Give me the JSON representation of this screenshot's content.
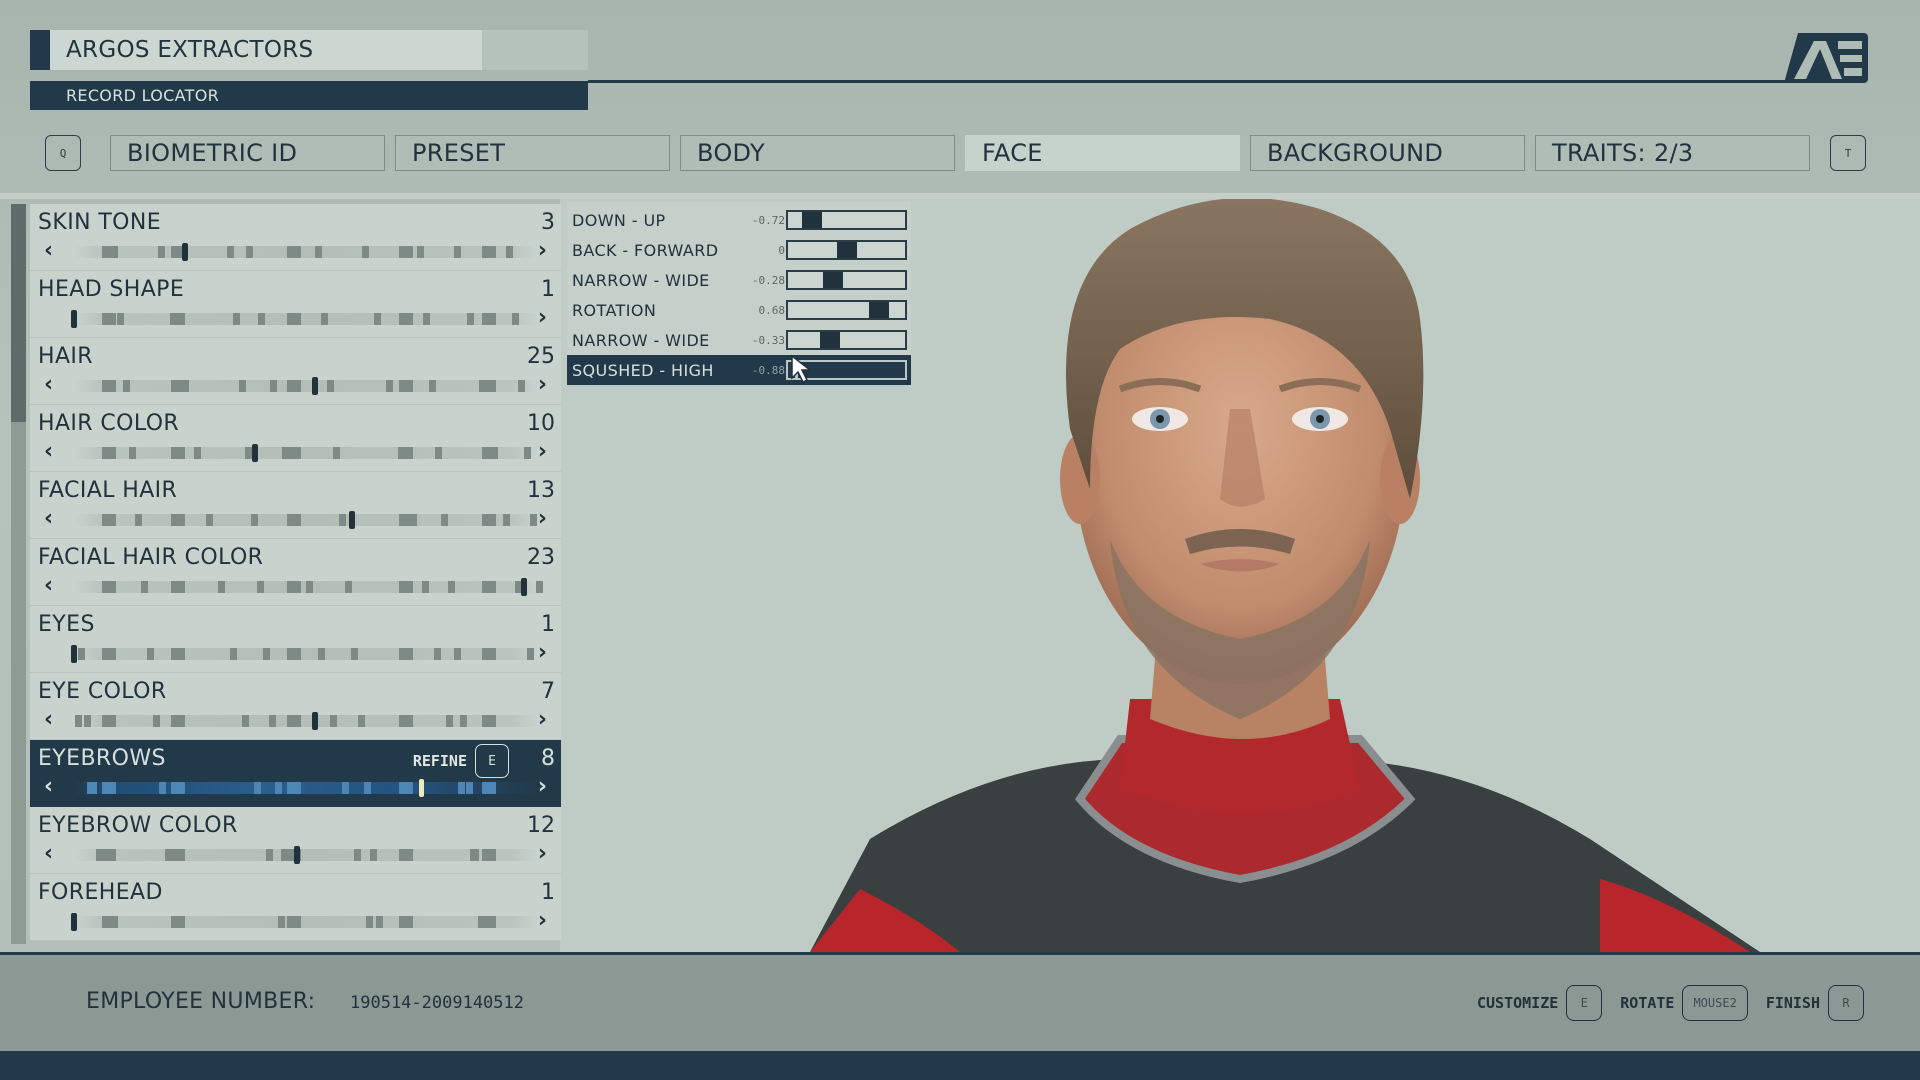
{
  "header": {
    "company": "ARGOS EXTRACTORS",
    "subtitle": "RECORD LOCATOR",
    "logo": "ae-logo"
  },
  "tabs": {
    "prev_key": "Q",
    "next_key": "T",
    "items": [
      {
        "label": "BIOMETRIC ID",
        "active": false
      },
      {
        "label": "PRESET",
        "active": false
      },
      {
        "label": "BODY",
        "active": false
      },
      {
        "label": "FACE",
        "active": true
      },
      {
        "label": "BACKGROUND",
        "active": false
      },
      {
        "label": "TRAITS: 2/3",
        "active": false
      }
    ]
  },
  "options": [
    {
      "label": "SKIN TONE",
      "value": "3",
      "position": 0.24,
      "has_prev": true,
      "has_next": true
    },
    {
      "label": "HEAD SHAPE",
      "value": "1",
      "position": 0.0,
      "has_prev": false,
      "has_next": true
    },
    {
      "label": "HAIR",
      "value": "25",
      "position": 0.52,
      "has_prev": true,
      "has_next": true
    },
    {
      "label": "HAIR COLOR",
      "value": "10",
      "position": 0.39,
      "has_prev": true,
      "has_next": true
    },
    {
      "label": "FACIAL HAIR",
      "value": "13",
      "position": 0.6,
      "has_prev": true,
      "has_next": true
    },
    {
      "label": "FACIAL HAIR COLOR",
      "value": "23",
      "position": 0.97,
      "has_prev": true,
      "has_next": false
    },
    {
      "label": "EYES",
      "value": "1",
      "position": 0.0,
      "has_prev": false,
      "has_next": true
    },
    {
      "label": "EYE COLOR",
      "value": "7",
      "position": 0.52,
      "has_prev": true,
      "has_next": true
    },
    {
      "label": "EYEBROWS",
      "value": "8",
      "position": 0.75,
      "has_prev": true,
      "has_next": true,
      "selected": true,
      "refine_label": "REFINE",
      "refine_key": "E"
    },
    {
      "label": "EYEBROW COLOR",
      "value": "12",
      "position": 0.48,
      "has_prev": true,
      "has_next": true
    },
    {
      "label": "FOREHEAD",
      "value": "1",
      "position": 0.0,
      "has_prev": false,
      "has_next": true
    }
  ],
  "refine_sliders": [
    {
      "label": "DOWN - UP",
      "value_text": "-0.72",
      "value": -0.72
    },
    {
      "label": "BACK - FORWARD",
      "value_text": "0",
      "value": 0
    },
    {
      "label": "NARROW - WIDE",
      "value_text": "-0.28",
      "value": -0.28
    },
    {
      "label": "ROTATION",
      "value_text": "0.68",
      "value": 0.68
    },
    {
      "label": "NARROW - WIDE",
      "value_text": "-0.33",
      "value": -0.33
    },
    {
      "label": "SQUSHED - HIGH",
      "value_text": "-0.88",
      "value": -0.88,
      "selected": true
    }
  ],
  "footer": {
    "employee_label": "EMPLOYEE NUMBER:",
    "employee_number": "190514-2009140512",
    "actions": [
      {
        "label": "CUSTOMIZE",
        "key": "E"
      },
      {
        "label": "ROTATE",
        "key": "MOUSE2"
      },
      {
        "label": "FINISH",
        "key": "R"
      }
    ]
  },
  "colors": {
    "accent_dark": "#22394a",
    "panel_light": "#c9d3ce",
    "background": "#b2bfb9",
    "selected_slider": "#2a5e8c",
    "slider_knob_selected": "#f1e7b8"
  }
}
